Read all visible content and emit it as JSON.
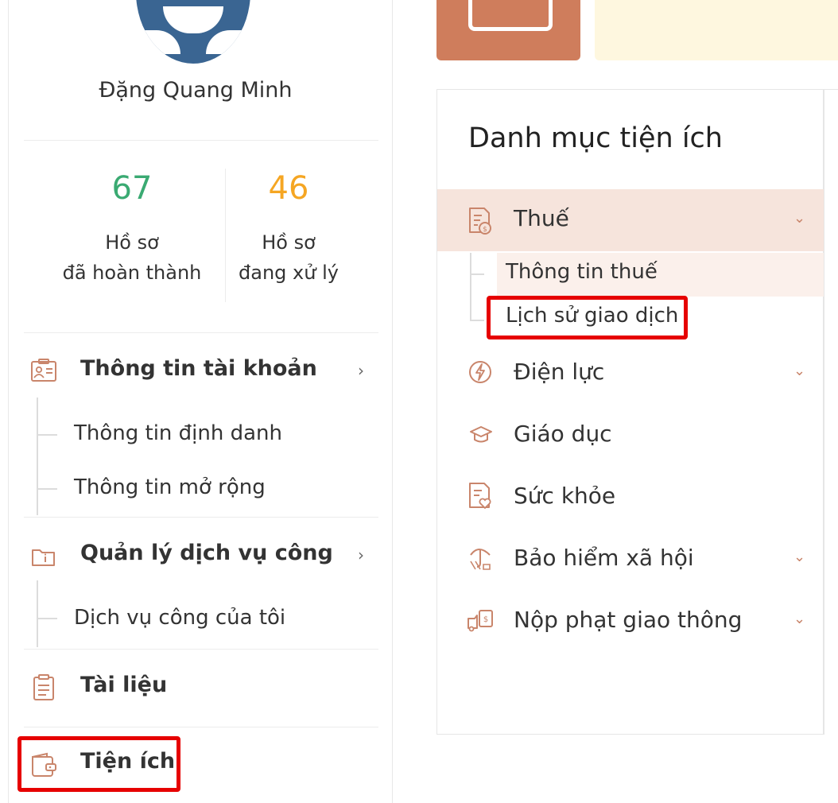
{
  "profile": {
    "name": "Đặng Quang Minh"
  },
  "stats": [
    {
      "value": "67",
      "line1": "Hồ sơ",
      "line2": "đã hoàn thành",
      "color": "#3aaa72"
    },
    {
      "value": "46",
      "line1": "Hồ sơ",
      "line2": "đang xử lý",
      "color": "#f5a623"
    }
  ],
  "sidebar": {
    "account": {
      "label": "Thông tin tài khoản",
      "icon": "id-card-icon",
      "children": [
        "Thông tin định danh",
        "Thông tin mở rộng"
      ]
    },
    "public_services": {
      "label": "Quản lý dịch vụ công",
      "icon": "folder-icon",
      "children": [
        "Dịch vụ công của tôi"
      ]
    },
    "documents": {
      "label": "Tài liệu",
      "icon": "document-icon"
    },
    "utilities": {
      "label": "Tiện ích",
      "icon": "wallet-icon",
      "highlighted": true
    }
  },
  "panel": {
    "title": "Danh mục tiện ích",
    "categories": [
      {
        "label": "Thuế",
        "icon": "tax-document-icon",
        "active": true,
        "expandable": true,
        "children": [
          "Thông tin thuế",
          "Lịch sử giao dịch"
        ]
      },
      {
        "label": "Điện lực",
        "icon": "lightning-icon",
        "expandable": true
      },
      {
        "label": "Giáo dục",
        "icon": "graduation-cap-icon",
        "expandable": false
      },
      {
        "label": "Sức khỏe",
        "icon": "health-record-icon",
        "expandable": false
      },
      {
        "label": "Bảo hiểm xã hội",
        "icon": "umbrella-icon",
        "expandable": true
      },
      {
        "label": "Nộp phạt giao thông",
        "icon": "traffic-fine-icon",
        "expandable": true
      }
    ]
  },
  "colors": {
    "accent": "#c9856b",
    "highlight_border": "#e60000",
    "active_row": "#f6e4dc"
  }
}
